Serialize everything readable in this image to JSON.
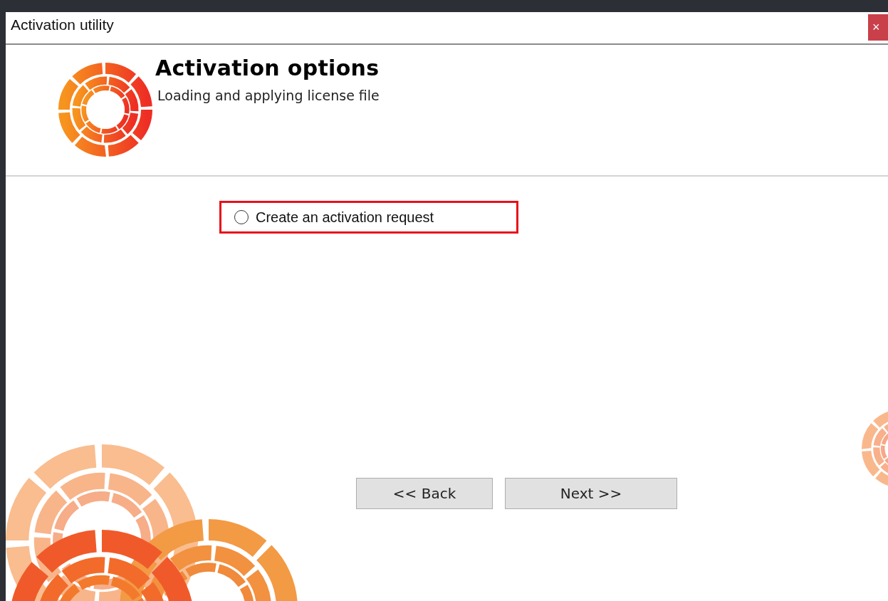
{
  "window": {
    "title": "Activation utility",
    "close_label": "×"
  },
  "header": {
    "title": "Activation options",
    "subtitle": "Loading and applying license file"
  },
  "options": [
    {
      "label": "Create an activation request",
      "selected": false,
      "highlighted": true
    }
  ],
  "buttons": [
    {
      "label": "<< Back"
    },
    {
      "label": "Next >>"
    }
  ]
}
